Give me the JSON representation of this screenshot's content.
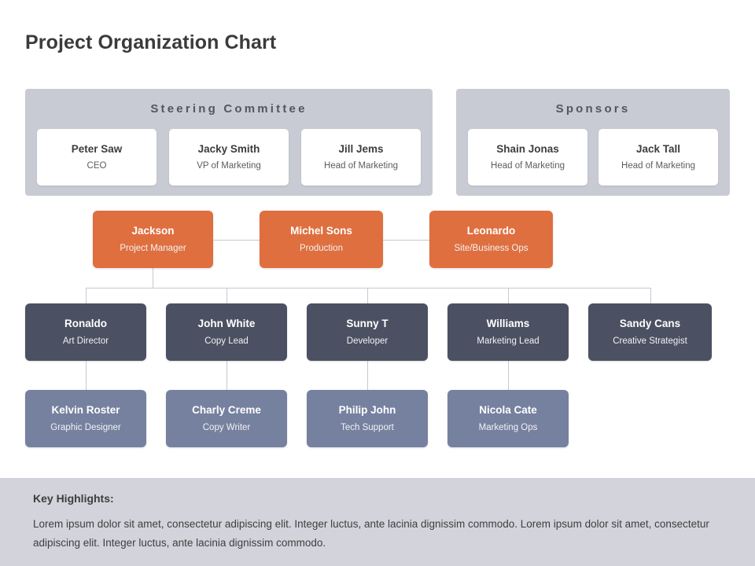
{
  "slide": {
    "title": "Project Organization Chart",
    "background_color": "#ffffff"
  },
  "colors": {
    "orange": "#df6f3f",
    "navy": "#4b5162",
    "slate": "#7681a0",
    "panel": "#c9cbd4",
    "footer_band": "#d2d3db",
    "connector": "#c9c9cd",
    "title_text": "#3b3b3b"
  },
  "groups": [
    {
      "title": "Steering Committee",
      "members": [
        {
          "name": "Peter Saw",
          "role": "CEO"
        },
        {
          "name": "Jacky Smith",
          "role": "VP of Marketing"
        },
        {
          "name": "Jill Jems",
          "role": "Head of Marketing"
        }
      ]
    },
    {
      "title": "Sponsors",
      "members": [
        {
          "name": "Shain Jonas",
          "role": "Head of Marketing"
        },
        {
          "name": "Jack Tall",
          "role": "Head of Marketing"
        }
      ]
    }
  ],
  "tiers": {
    "leadership": [
      {
        "name": "Jackson",
        "role": "Project Manager"
      },
      {
        "name": "Michel Sons",
        "role": "Production"
      },
      {
        "name": "Leonardo",
        "role": "Site/Business Ops"
      }
    ],
    "managers": [
      {
        "name": "Ronaldo",
        "role": "Art Director"
      },
      {
        "name": "John White",
        "role": "Copy Lead"
      },
      {
        "name": "Sunny T",
        "role": "Developer"
      },
      {
        "name": "Williams",
        "role": "Marketing Lead"
      },
      {
        "name": "Sandy Cans",
        "role": "Creative Strategist"
      }
    ],
    "staff": [
      {
        "name": "Kelvin Roster",
        "role": "Graphic Designer"
      },
      {
        "name": "Charly Creme",
        "role": "Copy Writer"
      },
      {
        "name": "Philip John",
        "role": "Tech Support"
      },
      {
        "name": "Nicola Cate",
        "role": "Marketing Ops"
      }
    ]
  },
  "footer": {
    "heading": "Key Highlights:",
    "body": "Lorem ipsum dolor sit amet, consectetur adipiscing elit. Integer luctus, ante lacinia dignissim commodo. Lorem ipsum dolor sit amet, consectetur adipiscing elit. Integer luctus, ante lacinia dignissim commodo."
  }
}
